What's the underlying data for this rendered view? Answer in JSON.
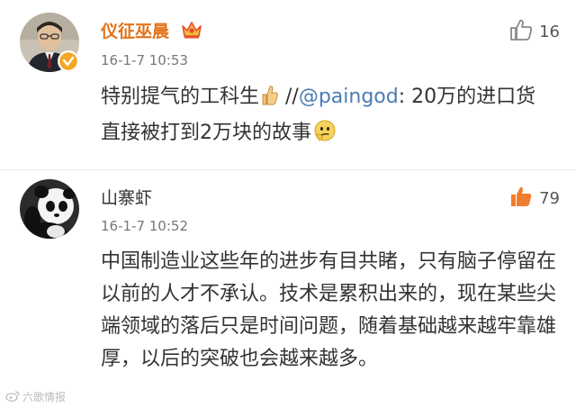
{
  "comments": [
    {
      "username": "仪征巫晨",
      "timestamp": "16-1-7 10:53",
      "like_count": "16",
      "text_before": "特别提气的工科生",
      "text_sep": " //",
      "mention": "@paingod",
      "text_after": ": 20万的进口货直接被打到2万块的故事",
      "like_active": false
    },
    {
      "username": "山寨虾",
      "timestamp": "16-1-7 10:52",
      "like_count": "79",
      "text": "中国制造业这些年的进步有目共睹，只有脑子停留在以前的人才不承认。技术是累积出来的，现在某些尖端领域的落后只是时间问题，随着基础越来越牢靠雄厚，以后的突破也会越来越多。",
      "like_active": true
    }
  ],
  "watermark": "六歌情报",
  "colors": {
    "username_vip": "#e3731a",
    "mention": "#4b7bb5",
    "like_active": "#f07d2c",
    "like_inactive": "#888888"
  },
  "icons": [
    "crown-icon",
    "verified-badge-icon",
    "thumbs-up-icon",
    "emoji-thumbs-up-icon",
    "emoji-thinking-icon"
  ]
}
